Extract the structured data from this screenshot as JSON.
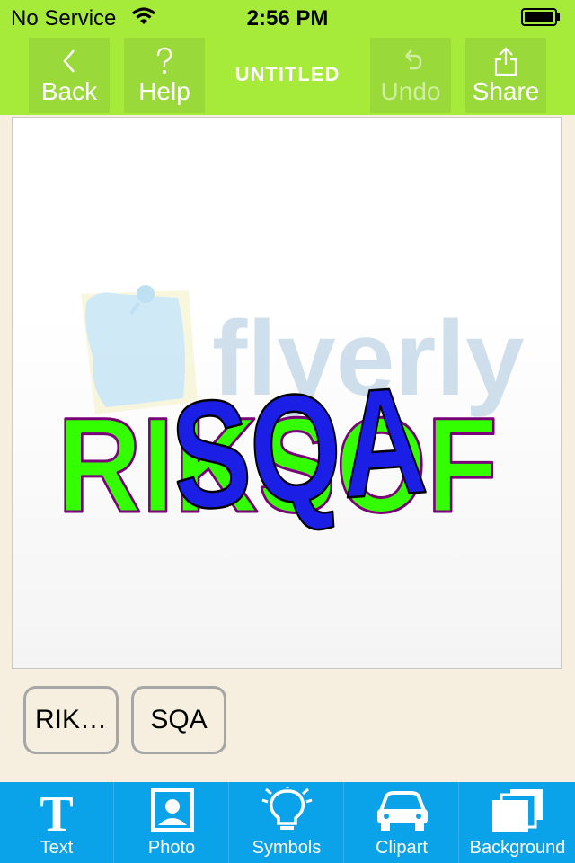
{
  "status": {
    "carrier": "No Service",
    "time": "2:56 PM"
  },
  "nav": {
    "back_label": "Back",
    "help_label": "Help",
    "title": "UNTITLED",
    "undo_label": "Undo",
    "share_label": "Share"
  },
  "canvas": {
    "watermark_text": "flyerly",
    "text_layer_1": "RIKSOF",
    "text_layer_2": "SQA",
    "colors": {
      "green": "#33ff00",
      "purple": "#7a007a",
      "blue": "#1b1fe6"
    }
  },
  "chips": [
    {
      "label": "RIK…"
    },
    {
      "label": "SQA"
    }
  ],
  "tabs": [
    {
      "label": "Text",
      "icon": "text-icon"
    },
    {
      "label": "Photo",
      "icon": "photo-icon"
    },
    {
      "label": "Symbols",
      "icon": "lightbulb-icon"
    },
    {
      "label": "Clipart",
      "icon": "car-icon"
    },
    {
      "label": "Background",
      "icon": "layers-icon"
    }
  ],
  "colors": {
    "bar": "#a6ea3a",
    "tabbar": "#0aa3ea",
    "workspace": "#f6efdf"
  }
}
